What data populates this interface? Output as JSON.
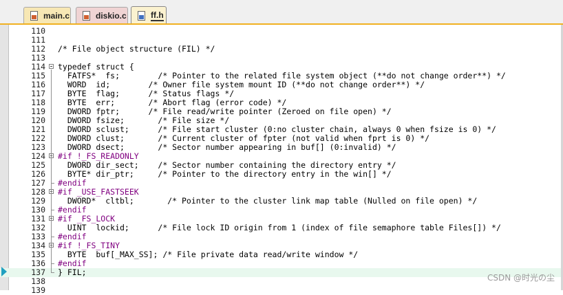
{
  "tabs": [
    {
      "label": "main.c",
      "type": "c",
      "active": false
    },
    {
      "label": "diskio.c",
      "type": "c",
      "active": false
    },
    {
      "label": "ff.h",
      "type": "h",
      "active": true
    }
  ],
  "editor": {
    "current_line": 137,
    "lines": [
      {
        "n": "110",
        "t": ""
      },
      {
        "n": "111",
        "t": ""
      },
      {
        "n": "112",
        "t": "/* File object structure (FIL) */"
      },
      {
        "n": "113",
        "t": ""
      },
      {
        "n": "114",
        "t": "typedef struct {"
      },
      {
        "n": "115",
        "t": "  FATFS*  fs;        /* Pointer to the related file system object (**do not change order**) */"
      },
      {
        "n": "116",
        "t": "  WORD  id;        /* Owner file system mount ID (**do not change order**) */"
      },
      {
        "n": "117",
        "t": "  BYTE  flag;      /* Status flags */"
      },
      {
        "n": "118",
        "t": "  BYTE  err;       /* Abort flag (error code) */"
      },
      {
        "n": "119",
        "t": "  DWORD fptr;      /* File read/write pointer (Zeroed on file open) */"
      },
      {
        "n": "120",
        "t": "  DWORD fsize;       /* File size */"
      },
      {
        "n": "121",
        "t": "  DWORD sclust;      /* File start cluster (0:no cluster chain, always 0 when fsize is 0) */"
      },
      {
        "n": "122",
        "t": "  DWORD clust;       /* Current cluster of fpter (not valid when fprt is 0) */"
      },
      {
        "n": "123",
        "t": "  DWORD dsect;       /* Sector number appearing in buf[] (0:invalid) */"
      },
      {
        "n": "124",
        "t": "#if !_FS_READONLY"
      },
      {
        "n": "125",
        "t": "  DWORD dir_sect;    /* Sector number containing the directory entry */"
      },
      {
        "n": "126",
        "t": "  BYTE* dir_ptr;     /* Pointer to the directory entry in the win[] */"
      },
      {
        "n": "127",
        "t": "#endif"
      },
      {
        "n": "128",
        "t": "#if _USE_FASTSEEK"
      },
      {
        "n": "129",
        "t": "  DWORD*  cltbl;       /* Pointer to the cluster link map table (Nulled on file open) */"
      },
      {
        "n": "130",
        "t": "#endif"
      },
      {
        "n": "131",
        "t": "#if _FS_LOCK"
      },
      {
        "n": "132",
        "t": "  UINT  lockid;      /* File lock ID origin from 1 (index of file semaphore table Files[]) */"
      },
      {
        "n": "133",
        "t": "#endif"
      },
      {
        "n": "134",
        "t": "#if !_FS_TINY"
      },
      {
        "n": "135",
        "t": "  BYTE  buf[_MAX_SS]; /* File private data read/write window */"
      },
      {
        "n": "136",
        "t": "#endif"
      },
      {
        "n": "137",
        "t": "} FIL;"
      },
      {
        "n": "138",
        "t": ""
      },
      {
        "n": "139",
        "t": ""
      }
    ]
  },
  "watermark": "CSDN @时光の尘"
}
